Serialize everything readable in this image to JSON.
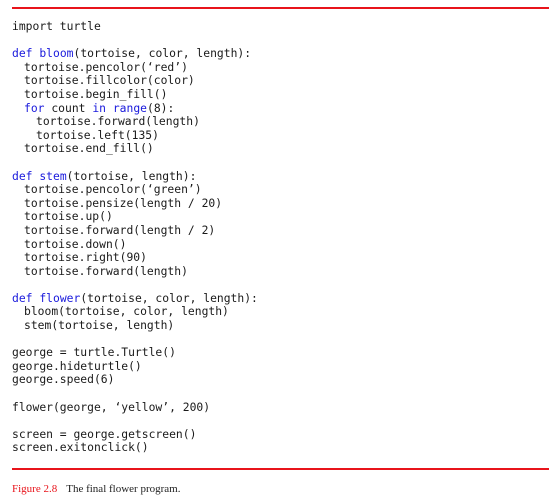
{
  "accent_color": "#e8141b",
  "keyword_color": "#1a1adc",
  "code_lines": [
    {
      "indent": 0,
      "tokens": [
        {
          "t": "import turtle",
          "kw": false
        }
      ]
    },
    {
      "indent": 0,
      "tokens": []
    },
    {
      "indent": 0,
      "tokens": [
        {
          "t": "def ",
          "kw": true
        },
        {
          "t": "bloom",
          "kw": true
        },
        {
          "t": "(tortoise, color, length):",
          "kw": false
        }
      ]
    },
    {
      "indent": 1,
      "tokens": [
        {
          "t": "tortoise.pencolor(‘red’)",
          "kw": false
        }
      ]
    },
    {
      "indent": 1,
      "tokens": [
        {
          "t": "tortoise.fillcolor(color)",
          "kw": false
        }
      ]
    },
    {
      "indent": 1,
      "tokens": [
        {
          "t": "tortoise.begin_fill()",
          "kw": false
        }
      ]
    },
    {
      "indent": 1,
      "tokens": [
        {
          "t": "for",
          "kw": true
        },
        {
          "t": " count ",
          "kw": false
        },
        {
          "t": "in",
          "kw": true
        },
        {
          "t": " ",
          "kw": false
        },
        {
          "t": "range",
          "kw": true
        },
        {
          "t": "(8):",
          "kw": false
        }
      ]
    },
    {
      "indent": 2,
      "tokens": [
        {
          "t": "tortoise.forward(length)",
          "kw": false
        }
      ]
    },
    {
      "indent": 2,
      "tokens": [
        {
          "t": "tortoise.left(135)",
          "kw": false
        }
      ]
    },
    {
      "indent": 1,
      "tokens": [
        {
          "t": "tortoise.end_fill()",
          "kw": false
        }
      ]
    },
    {
      "indent": 0,
      "tokens": []
    },
    {
      "indent": 0,
      "tokens": [
        {
          "t": "def ",
          "kw": true
        },
        {
          "t": "stem",
          "kw": true
        },
        {
          "t": "(tortoise, length):",
          "kw": false
        }
      ]
    },
    {
      "indent": 1,
      "tokens": [
        {
          "t": "tortoise.pencolor(‘green’)",
          "kw": false
        }
      ]
    },
    {
      "indent": 1,
      "tokens": [
        {
          "t": "tortoise.pensize(length / 20)",
          "kw": false
        }
      ]
    },
    {
      "indent": 1,
      "tokens": [
        {
          "t": "tortoise.up()",
          "kw": false
        }
      ]
    },
    {
      "indent": 1,
      "tokens": [
        {
          "t": "tortoise.forward(length / 2)",
          "kw": false
        }
      ]
    },
    {
      "indent": 1,
      "tokens": [
        {
          "t": "tortoise.down()",
          "kw": false
        }
      ]
    },
    {
      "indent": 1,
      "tokens": [
        {
          "t": "tortoise.right(90)",
          "kw": false
        }
      ]
    },
    {
      "indent": 1,
      "tokens": [
        {
          "t": "tortoise.forward(length)",
          "kw": false
        }
      ]
    },
    {
      "indent": 0,
      "tokens": []
    },
    {
      "indent": 0,
      "tokens": [
        {
          "t": "def ",
          "kw": true
        },
        {
          "t": "flower",
          "kw": true
        },
        {
          "t": "(tortoise, color, length):",
          "kw": false
        }
      ]
    },
    {
      "indent": 1,
      "tokens": [
        {
          "t": "bloom(tortoise, color, length)",
          "kw": false
        }
      ]
    },
    {
      "indent": 1,
      "tokens": [
        {
          "t": "stem(tortoise, length)",
          "kw": false
        }
      ]
    },
    {
      "indent": 0,
      "tokens": []
    },
    {
      "indent": 0,
      "tokens": [
        {
          "t": "george = turtle.Turtle()",
          "kw": false
        }
      ]
    },
    {
      "indent": 0,
      "tokens": [
        {
          "t": "george.hideturtle()",
          "kw": false
        }
      ]
    },
    {
      "indent": 0,
      "tokens": [
        {
          "t": "george.speed(6)",
          "kw": false
        }
      ]
    },
    {
      "indent": 0,
      "tokens": []
    },
    {
      "indent": 0,
      "tokens": [
        {
          "t": "flower(george, ‘yellow’, 200)",
          "kw": false
        }
      ]
    },
    {
      "indent": 0,
      "tokens": []
    },
    {
      "indent": 0,
      "tokens": [
        {
          "t": "screen = george.getscreen()",
          "kw": false
        }
      ]
    },
    {
      "indent": 0,
      "tokens": [
        {
          "t": "screen.exitonclick()",
          "kw": false
        }
      ]
    }
  ],
  "caption": {
    "figure_number": "Figure 2.8",
    "text": "The final flower program."
  }
}
